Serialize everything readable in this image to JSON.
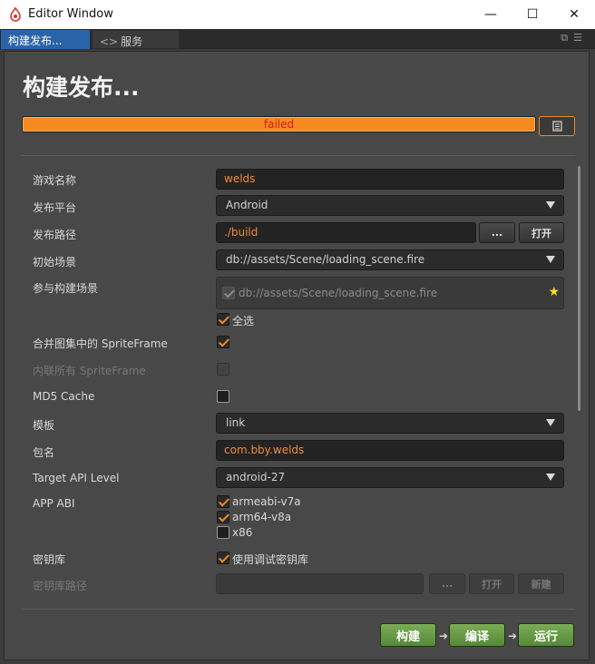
{
  "window": {
    "title": "Editor Window",
    "minimize": "—",
    "maximize": "☐",
    "close": "✕"
  },
  "tabs": [
    {
      "label": "构建发布..."
    },
    {
      "label": "服务"
    }
  ],
  "heading": "构建发布...",
  "progress": {
    "status_text": "failed",
    "percent": 100
  },
  "fields": {
    "game_name": {
      "label": "游戏名称",
      "value": "welds"
    },
    "platform": {
      "label": "发布平台",
      "value": "Android"
    },
    "build_path": {
      "label": "发布路径",
      "value": "./build",
      "browse_label": "...",
      "open_label": "打开"
    },
    "start_scene": {
      "label": "初始场景",
      "value": "db://assets/Scene/loading_scene.fire"
    },
    "included_scenes": {
      "label": "参与构建场景",
      "scene": "db://assets/Scene/loading_scene.fire",
      "select_all_label": "全选"
    },
    "merge_spriteframe": {
      "label": "合并图集中的 SpriteFrame",
      "checked": true
    },
    "inline_spriteframe": {
      "label": "内联所有 SpriteFrame",
      "checked": false
    },
    "md5_cache": {
      "label": "MD5 Cache",
      "checked": false
    },
    "template": {
      "label": "模板",
      "value": "link"
    },
    "package_name": {
      "label": "包名",
      "value": "com.bby.welds"
    },
    "target_api": {
      "label": "Target API Level",
      "value": "android-27"
    },
    "app_abi": {
      "label": "APP ABI",
      "options": [
        {
          "name": "armeabi-v7a",
          "checked": true
        },
        {
          "name": "arm64-v8a",
          "checked": true
        },
        {
          "name": "x86",
          "checked": false
        }
      ]
    },
    "keystore": {
      "label": "密钥库",
      "use_debug_label": "使用调试密钥库",
      "checked": true
    },
    "keystore_path": {
      "label": "密钥库路径",
      "value": "",
      "browse_label": "...",
      "open_label": "打开",
      "new_label": "新建"
    }
  },
  "actions": {
    "build": "构建",
    "compile": "编译",
    "run": "运行"
  },
  "colors": {
    "accent": "#f58a20",
    "error_text": "#d31c1c",
    "tab_active": "#2a64a8",
    "action_green": "#6a9b48"
  }
}
